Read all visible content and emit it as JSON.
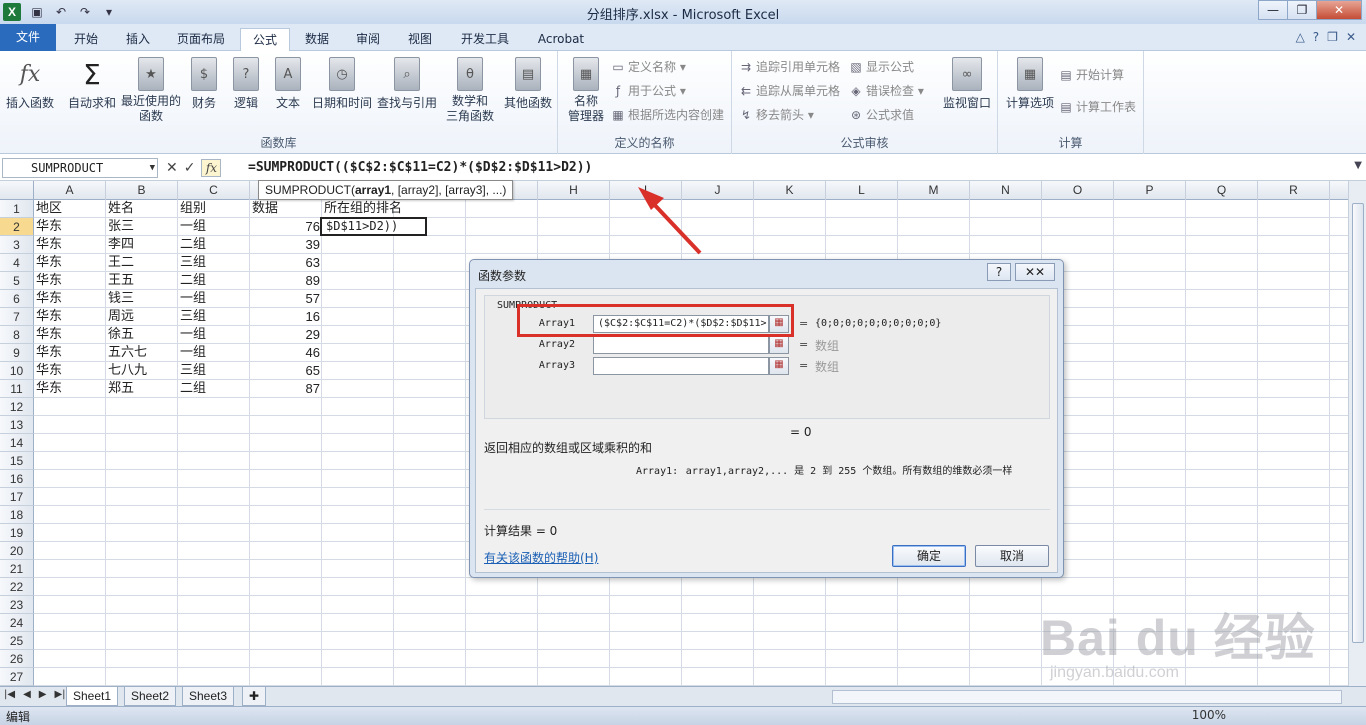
{
  "window": {
    "title": "分组排序.xlsx - Microsoft Excel",
    "app_logo": "X",
    "qat_icons": [
      "save-icon",
      "undo-icon",
      "redo-icon",
      "customize-icon"
    ]
  },
  "ribbon_tabs": [
    "文件",
    "开始",
    "插入",
    "页面布局",
    "公式",
    "数据",
    "审阅",
    "视图",
    "开发工具",
    "Acrobat"
  ],
  "active_tab": "公式",
  "ribbon": {
    "function_library": {
      "label": "函数库",
      "insert_function": "插入函数",
      "autosum": "自动求和",
      "recent": "最近使用的\n函数",
      "financial": "财务",
      "logical": "逻辑",
      "text": "文本",
      "datetime": "日期和时间",
      "lookup": "查找与引用",
      "math": "数学和\n三角函数",
      "more": "其他函数"
    },
    "defined_names": {
      "label": "定义的名称",
      "name_manager": "名称\n管理器",
      "define_name": "定义名称",
      "use_in_formula": "用于公式",
      "create_from_selection": "根据所选内容创建"
    },
    "formula_auditing": {
      "label": "公式审核",
      "trace_precedents": "追踪引用单元格",
      "trace_dependents": "追踪从属单元格",
      "remove_arrows": "移去箭头",
      "show_formulas": "显示公式",
      "error_checking": "错误检查",
      "evaluate_formula": "公式求值",
      "watch_window": "监视窗口"
    },
    "calculation": {
      "label": "计算",
      "calc_options": "计算选项",
      "calc_now": "开始计算",
      "calc_sheet": "计算工作表"
    }
  },
  "formula_bar": {
    "name_box": "SUMPRODUCT",
    "cancel": "✕",
    "enter": "✓",
    "fx": "fx",
    "formula": "=SUMPRODUCT(($C$2:$C$11=C2)*($D$2:$D$11>D2))"
  },
  "tooltip": {
    "func": "SUMPRODUCT(",
    "arg1": "array1",
    "rest": ", [array2], [array3], ...)"
  },
  "columns": [
    "A",
    "B",
    "C",
    "D",
    "E",
    "F",
    "G",
    "H",
    "I",
    "J",
    "K",
    "L",
    "M",
    "N",
    "O",
    "P",
    "Q",
    "R"
  ],
  "rows": [
    "1",
    "2",
    "3",
    "4",
    "5",
    "6",
    "7",
    "8",
    "9",
    "10",
    "11",
    "12",
    "13",
    "14",
    "15",
    "16",
    "17",
    "18",
    "19",
    "20",
    "21",
    "22",
    "23",
    "24",
    "25",
    "26",
    "27"
  ],
  "headers": [
    "地区",
    "姓名",
    "组别",
    "数据",
    "所在组的排名"
  ],
  "table": [
    [
      "华东",
      "张三",
      "一组",
      "76"
    ],
    [
      "华东",
      "李四",
      "二组",
      "39"
    ],
    [
      "华东",
      "王二",
      "三组",
      "63"
    ],
    [
      "华东",
      "王五",
      "二组",
      "89"
    ],
    [
      "华东",
      "钱三",
      "一组",
      "57"
    ],
    [
      "华东",
      "周远",
      "三组",
      "16"
    ],
    [
      "华东",
      "徐五",
      "一组",
      "29"
    ],
    [
      "华东",
      "五六七",
      "一组",
      "46"
    ],
    [
      "华东",
      "七八九",
      "三组",
      "65"
    ],
    [
      "华东",
      "郑五",
      "二组",
      "87"
    ]
  ],
  "active_cell_text": "$D$11>D2))",
  "dialog": {
    "title": "函数参数",
    "help": "?",
    "close": "✕✕",
    "function_name": "SUMPRODUCT",
    "args": [
      {
        "label": "Array1",
        "value": "($C$2:$C$11=C2)*($D$2:$D$11>",
        "result": "{0;0;0;0;0;0;0;0;0;0}"
      },
      {
        "label": "Array2",
        "value": "",
        "result": "数组"
      },
      {
        "label": "Array3",
        "value": "",
        "result": "数组"
      }
    ],
    "total_result": "= 0",
    "description": "返回相应的数组或区域乘积的和",
    "arg_help_label": "Array1:",
    "arg_help_text": "array1,array2,... 是 2 到 255 个数组。所有数组的维数必须一样",
    "calc_result": "计算结果 = 0",
    "help_link": "有关该函数的帮助(H)",
    "ok": "确定",
    "cancel": "取消"
  },
  "sheets": [
    "Sheet1",
    "Sheet2",
    "Sheet3"
  ],
  "status": {
    "mode": "编辑",
    "zoom": "100%"
  },
  "watermark": {
    "main": "Bai du 经验",
    "sub": "jingyan.baidu.com"
  },
  "colors": {
    "file_tab": "#2a6bbd",
    "annotation_red": "#d9302a",
    "row_selected": "#f7d98f"
  }
}
